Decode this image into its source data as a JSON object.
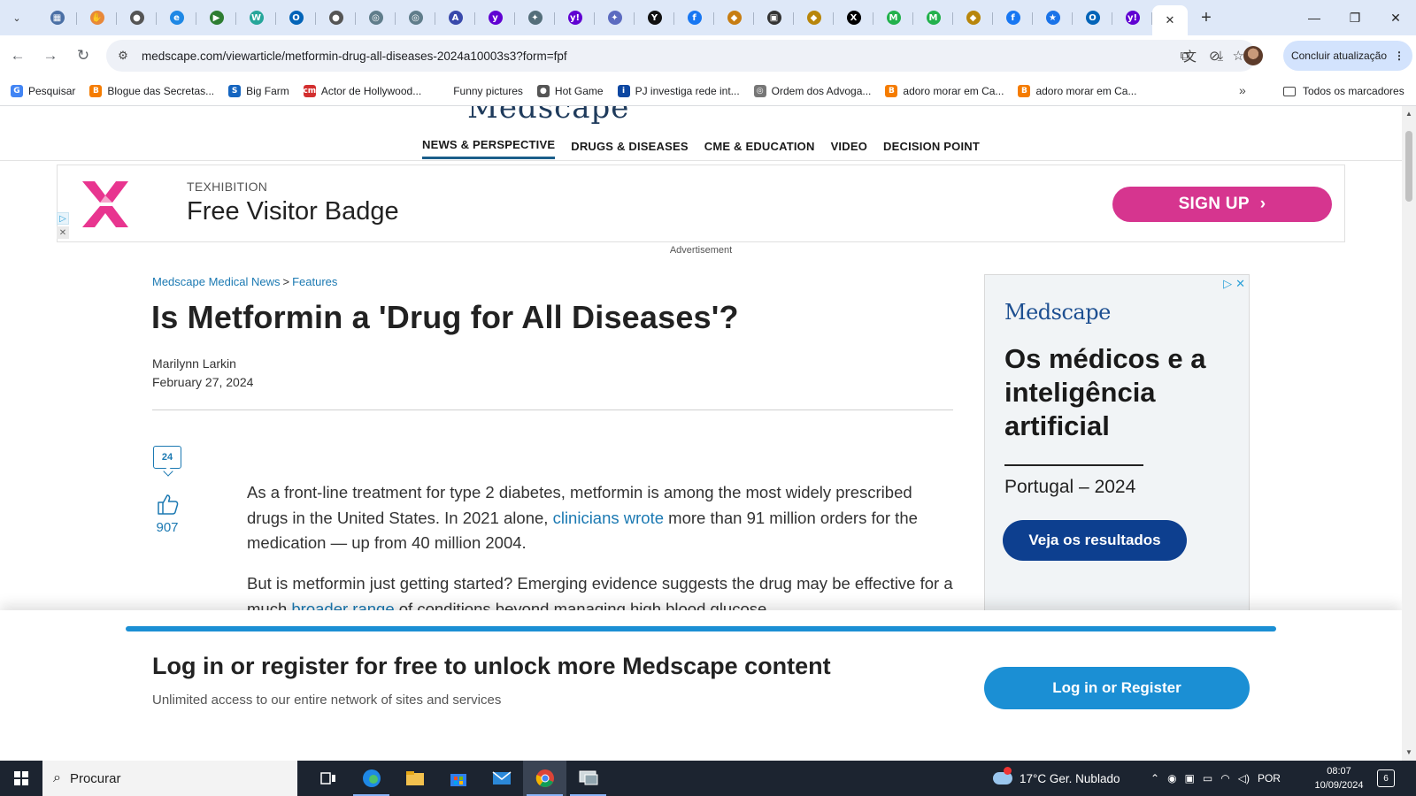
{
  "browser": {
    "tabs": [
      {
        "icon": "grid-tab-icon",
        "color": "#4a6fa5",
        "glyph": "▦"
      },
      {
        "icon": "hand-tab-icon",
        "color": "#e8883a",
        "glyph": "✋"
      },
      {
        "icon": "globe-tab-icon",
        "color": "#555555",
        "glyph": "●"
      },
      {
        "icon": "edge-tab-icon",
        "color": "#1e88e5",
        "glyph": "e"
      },
      {
        "icon": "play-tab-icon",
        "color": "#2e7d32",
        "glyph": "▶"
      },
      {
        "icon": "w-tab-icon",
        "color": "#26a69a",
        "glyph": "W"
      },
      {
        "icon": "outlook-tab-icon",
        "color": "#0364b8",
        "glyph": "O"
      },
      {
        "icon": "globe-tab-icon",
        "color": "#555555",
        "glyph": "●"
      },
      {
        "icon": "settings-tab-icon",
        "color": "#607d8b",
        "glyph": "◎"
      },
      {
        "icon": "settings-tab-icon",
        "color": "#607d8b",
        "glyph": "◎"
      },
      {
        "icon": "a-tab-icon",
        "color": "#3949ab",
        "glyph": "A"
      },
      {
        "icon": "yahoo-tab-icon",
        "color": "#6001d2",
        "glyph": "y"
      },
      {
        "icon": "compass-tab-icon",
        "color": "#546e7a",
        "glyph": "✦"
      },
      {
        "icon": "yahoo-tab-icon",
        "color": "#6001d2",
        "glyph": "y!"
      },
      {
        "icon": "compass-tab-icon",
        "color": "#5c6bc0",
        "glyph": "✦"
      },
      {
        "icon": "y-tab-icon",
        "color": "#111111",
        "glyph": "Y"
      },
      {
        "icon": "facebook-tab-icon",
        "color": "#1877f2",
        "glyph": "f"
      },
      {
        "icon": "game-tab-icon",
        "color": "#c77d12",
        "glyph": "◆"
      },
      {
        "icon": "media-tab-icon",
        "color": "#333333",
        "glyph": "▣"
      },
      {
        "icon": "game-tab-icon",
        "color": "#b8860b",
        "glyph": "◆"
      },
      {
        "icon": "x-tab-icon",
        "color": "#000000",
        "glyph": "X"
      },
      {
        "icon": "m-tab-icon",
        "color": "#22b14c",
        "glyph": "M"
      },
      {
        "icon": "m-tab-icon",
        "color": "#22b14c",
        "glyph": "M"
      },
      {
        "icon": "game-tab-icon",
        "color": "#b8860b",
        "glyph": "◆"
      },
      {
        "icon": "facebook-tab-icon",
        "color": "#1877f2",
        "glyph": "f"
      },
      {
        "icon": "star-tab-icon",
        "color": "#1a73e8",
        "glyph": "★"
      },
      {
        "icon": "outlook-tab-icon",
        "color": "#0364b8",
        "glyph": "O"
      },
      {
        "icon": "yahoo-tab-icon",
        "color": "#6001d2",
        "glyph": "y!"
      }
    ],
    "active_tab_close": "✕",
    "new_tab": "+",
    "window_controls": {
      "minimize": "—",
      "restore": "❐",
      "close": "✕"
    },
    "url": "medscape.com/viewarticle/metformin-drug-all-diseases-2024a10003s3?form=fpf",
    "update_button": "Concluir atualização",
    "bookmarks": [
      {
        "label": "Pesquisar",
        "color": "#4285f4",
        "glyph": "G"
      },
      {
        "label": "Blogue das Secretas...",
        "color": "#f57c00",
        "glyph": "B"
      },
      {
        "label": "Big Farm",
        "color": "#1565c0",
        "glyph": "S"
      },
      {
        "label": "Actor de Hollywood...",
        "color": "#d32f2f",
        "glyph": "cm"
      },
      {
        "label": "Funny pictures",
        "color": "#ffffff",
        "glyph": ""
      },
      {
        "label": "Hot Game",
        "color": "#555555",
        "glyph": "●"
      },
      {
        "label": "PJ investiga rede int...",
        "color": "#0d47a1",
        "glyph": "i"
      },
      {
        "label": "Ordem dos Advoga...",
        "color": "#777777",
        "glyph": "◎"
      },
      {
        "label": "adoro morar em Ca...",
        "color": "#f57c00",
        "glyph": "B"
      },
      {
        "label": "adoro morar em Ca...",
        "color": "#f57c00",
        "glyph": "B"
      }
    ],
    "bookmarks_more": "»",
    "all_bookmarks": "Todos os marcadores"
  },
  "site": {
    "nav": [
      "NEWS & PERSPECTIVE",
      "DRUGS & DISEASES",
      "CME & EDUCATION",
      "VIDEO",
      "DECISION POINT"
    ]
  },
  "banner_ad": {
    "brand": "TEXHIBITION",
    "title": "Free Visitor Badge",
    "cta": "SIGN UP",
    "label": "Advertisement"
  },
  "article": {
    "breadcrumb": [
      "Medscape Medical News",
      "Features"
    ],
    "title": "Is Metformin a 'Drug for All Diseases'?",
    "author": "Marilynn Larkin",
    "date": "February 27, 2024",
    "comments": "24",
    "likes": "907",
    "p1_a": "As a front-line treatment for type 2 diabetes, metformin is among the most widely prescribed drugs in the United States. In 2021 alone, ",
    "p1_link": "clinicians wrote",
    "p1_b": " more than 91 million orders for the medication — up from 40 million 2004.",
    "p2_a": "But is metformin just getting started? Emerging evidence suggests the drug may be effective for a much ",
    "p2_link": "broader range",
    "p2_b": " of conditions beyond managing high blood glucose,"
  },
  "side_ad": {
    "logo": "Medscape",
    "headline": "Os médicos e a inteligência artificial",
    "sub": "Portugal – 2024",
    "cta": "Veja os resultados"
  },
  "login_overlay": {
    "title": "Log in or register for free to unlock more Medscape content",
    "subtitle": "Unlimited access to our entire network of sites and services",
    "button": "Log in or Register"
  },
  "taskbar": {
    "search": "Procurar",
    "weather": "17°C  Ger. Nublado",
    "language": "POR",
    "time": "08:07",
    "date": "10/09/2024",
    "notifications": "6"
  },
  "colors": {
    "accent": "#1b79b2",
    "signup": "#d6358f",
    "side_button": "#0d3f8f",
    "login_button": "#1b8fd4"
  }
}
